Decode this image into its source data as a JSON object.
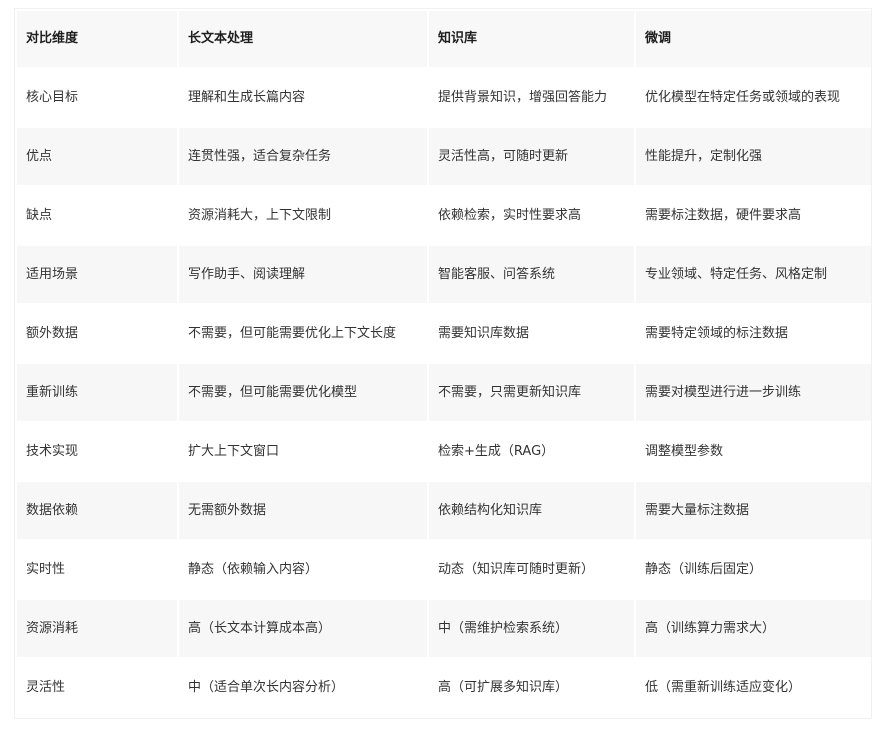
{
  "table": {
    "headers": [
      "对比维度",
      "长文本处理",
      "知识库",
      "微调"
    ],
    "rows": [
      [
        "核心目标",
        "理解和生成长篇内容",
        "提供背景知识，增强回答能力",
        "优化模型在特定任务或领域的表现"
      ],
      [
        "优点",
        "连贯性强，适合复杂任务",
        "灵活性高，可随时更新",
        "性能提升，定制化强"
      ],
      [
        "缺点",
        "资源消耗大，上下文限制",
        "依赖检索，实时性要求高",
        "需要标注数据，硬件要求高"
      ],
      [
        "适用场景",
        "写作助手、阅读理解",
        "智能客服、问答系统",
        "专业领域、特定任务、风格定制"
      ],
      [
        "额外数据",
        "不需要，但可能需要优化上下文长度",
        "需要知识库数据",
        "需要特定领域的标注数据"
      ],
      [
        "重新训练",
        "不需要，但可能需要优化模型",
        "不需要，只需更新知识库",
        "需要对模型进行进一步训练"
      ],
      [
        "技术实现",
        "扩大上下文窗口",
        "检索+生成（RAG）",
        "调整模型参数"
      ],
      [
        "数据依赖",
        "无需额外数据",
        "依赖结构化知识库",
        "需要大量标注数据"
      ],
      [
        "实时性",
        "静态（依赖输入内容）",
        "动态（知识库可随时更新）",
        "静态（训练后固定）"
      ],
      [
        "资源消耗",
        "高（长文本计算成本高）",
        "中（需维护检索系统）",
        "高（训练算力需求大）"
      ],
      [
        "灵活性",
        "中（适合单次长内容分析）",
        "高（可扩展多知识库）",
        "低（需重新训练适应变化）"
      ]
    ]
  }
}
